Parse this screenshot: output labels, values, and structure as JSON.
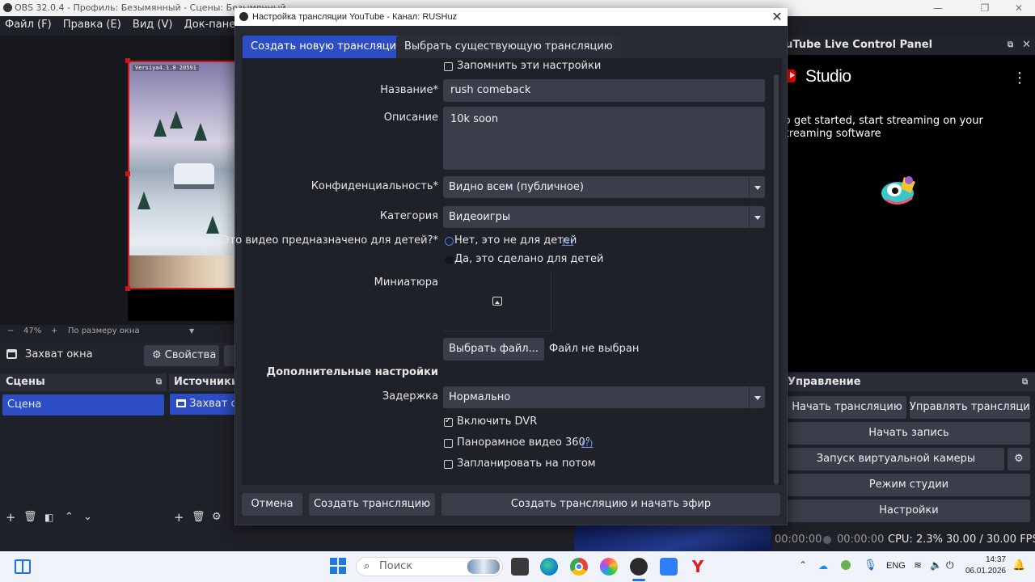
{
  "obs": {
    "title": "OBS 32.0.4 - Профиль: Безымянный - Сцены: Безымянный",
    "menu": [
      "Файл (F)",
      "Правка (E)",
      "Вид (V)",
      "Док-панели (D)"
    ],
    "hud_text": "Versiya4.1.0 20591",
    "zoom": "47%",
    "zoom_mode": "По размеру окна",
    "source_name": "Захват окна",
    "properties_label": "Свойства",
    "scenes_title": "Сцены",
    "scene_item": "Сцена",
    "sources_title": "Источники",
    "source_item": "Захват окна"
  },
  "yt_dock": {
    "title": "YouTube Live Control Panel",
    "studio_label": "Studio",
    "message": "To get started, start streaming on your streaming software"
  },
  "controls": {
    "title": "Управление",
    "start_stream": "Начать трансляцию",
    "manage_stream": "Управлять трансляцией",
    "start_record": "Начать запись",
    "virtual_cam": "Запуск виртуальной камеры",
    "studio_mode": "Режим студии",
    "settings": "Настройки"
  },
  "status": {
    "rec_time": "00:00:00",
    "stream_time": "00:00:00",
    "cpu": "CPU: 2.3%",
    "fps": "30.00 / 30.00 FPS"
  },
  "dialog": {
    "title": "Настройка трансляции YouTube - Канал: RUSHuz",
    "tabs": [
      "Создать новую трансляцию",
      "Выбрать существующую трансляцию"
    ],
    "remember": "Запомнить эти настройки",
    "title_label": "Название*",
    "title_value": "rush comeback",
    "desc_label": "Описание",
    "desc_value": "10k soon",
    "privacy_label": "Конфиденциальность*",
    "privacy_value": "Видно всем (публичное)",
    "category_label": "Категория",
    "category_value": "Видеоигры",
    "kids_label": "Это видео предназначено для детей?*",
    "kids_no": "Нет, это не для детей",
    "kids_yes": "Да, это сделано для детей",
    "help_mark": "(?)",
    "thumb_label": "Миниатюра",
    "choose_file": "Выбрать файл...",
    "no_file": "Файл не выбран",
    "advanced": "Дополнительные настройки",
    "latency_label": "Задержка",
    "latency_value": "Нормально",
    "dvr": "Включить DVR",
    "dvr_checked": true,
    "pano": "Панорамное видео 360°",
    "schedule": "Запланировать на потом",
    "cancel": "Отмена",
    "create": "Создать трансляцию",
    "create_start": "Создать трансляцию и начать эфир"
  },
  "taskbar": {
    "search_placeholder": "Поиск",
    "lang": "ENG",
    "time": "14:37",
    "date": "06.01.2026"
  },
  "colors": {
    "accent": "#2c4dc4",
    "dialog_bg": "#272a33",
    "field_bg": "#3b3e4a",
    "selection_border": "#d0141a",
    "youtube_red": "#ff0000"
  }
}
